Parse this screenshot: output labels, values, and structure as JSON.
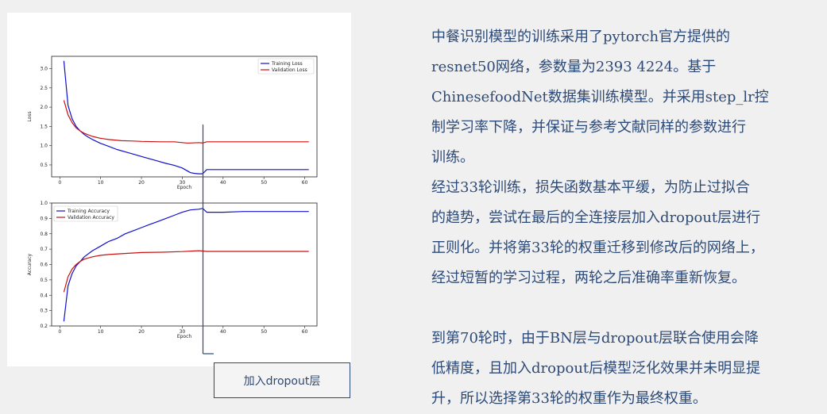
{
  "chart_data": [
    {
      "type": "line",
      "xlabel": "Epoch",
      "ylabel": "Loss",
      "xlim": [
        -2,
        63
      ],
      "ylim": [
        0.19,
        3.32
      ],
      "xticks": [
        0,
        10,
        20,
        30,
        40,
        50,
        60
      ],
      "yticks": [
        0.5,
        1.0,
        1.5,
        2.0,
        2.5,
        3.0
      ],
      "ytick_labels": [
        "0.5",
        "1.0",
        "1.5",
        "2.0",
        "2.5",
        "3.0"
      ],
      "legend_position": "top-right",
      "grid": false,
      "series": [
        {
          "name": "Training Loss",
          "color": "#1010cc",
          "x": [
            1,
            2,
            3,
            4,
            5,
            6,
            7,
            8,
            10,
            12,
            14,
            16,
            18,
            20,
            22,
            24,
            26,
            28,
            30,
            32,
            33,
            34,
            35,
            36,
            40,
            45,
            50,
            55,
            60,
            61
          ],
          "y": [
            3.2,
            2.05,
            1.7,
            1.5,
            1.38,
            1.29,
            1.22,
            1.16,
            1.06,
            0.98,
            0.9,
            0.84,
            0.78,
            0.72,
            0.66,
            0.6,
            0.54,
            0.49,
            0.42,
            0.3,
            0.28,
            0.27,
            0.27,
            0.38,
            0.38,
            0.38,
            0.38,
            0.38,
            0.38,
            0.38
          ]
        },
        {
          "name": "Validation Loss",
          "color": "#cc1010",
          "x": [
            1,
            2,
            3,
            4,
            5,
            6,
            8,
            10,
            12,
            15,
            18,
            20,
            25,
            28,
            29,
            30,
            31,
            32,
            34,
            35,
            36,
            40,
            45,
            50,
            55,
            60,
            61
          ],
          "y": [
            2.18,
            1.8,
            1.6,
            1.46,
            1.38,
            1.32,
            1.24,
            1.19,
            1.16,
            1.13,
            1.12,
            1.11,
            1.1,
            1.1,
            1.09,
            1.08,
            1.07,
            1.07,
            1.08,
            1.07,
            1.1,
            1.1,
            1.1,
            1.1,
            1.1,
            1.1,
            1.1
          ]
        }
      ]
    },
    {
      "type": "line",
      "xlabel": "Epoch",
      "ylabel": "Accuracy",
      "xlim": [
        -2,
        63
      ],
      "ylim": [
        0.2,
        1.0
      ],
      "xticks": [
        0,
        10,
        20,
        30,
        40,
        50,
        60
      ],
      "yticks": [
        0.2,
        0.3,
        0.4,
        0.5,
        0.6,
        0.7,
        0.8,
        0.9,
        1.0
      ],
      "ytick_labels": [
        "0.2",
        "0.3",
        "0.4",
        "0.5",
        "0.6",
        "0.7",
        "0.8",
        "0.9",
        "1.0"
      ],
      "legend_position": "top-left",
      "grid": false,
      "series": [
        {
          "name": "Training Accuracy",
          "color": "#1010cc",
          "x": [
            1,
            2,
            3,
            4,
            5,
            6,
            8,
            10,
            12,
            14,
            16,
            18,
            20,
            22,
            24,
            26,
            28,
            30,
            32,
            34,
            35,
            36,
            40,
            45,
            50,
            55,
            60,
            61
          ],
          "y": [
            0.23,
            0.46,
            0.54,
            0.59,
            0.62,
            0.65,
            0.69,
            0.72,
            0.75,
            0.77,
            0.8,
            0.82,
            0.84,
            0.86,
            0.88,
            0.9,
            0.92,
            0.94,
            0.955,
            0.96,
            0.965,
            0.94,
            0.94,
            0.945,
            0.945,
            0.945,
            0.945,
            0.945
          ]
        },
        {
          "name": "Validation Accuracy",
          "color": "#cc1010",
          "x": [
            1,
            2,
            3,
            4,
            5,
            6,
            8,
            10,
            12,
            15,
            18,
            20,
            25,
            30,
            34,
            35,
            36,
            40,
            45,
            50,
            55,
            60,
            61
          ],
          "y": [
            0.42,
            0.52,
            0.57,
            0.6,
            0.62,
            0.635,
            0.65,
            0.66,
            0.665,
            0.67,
            0.675,
            0.678,
            0.68,
            0.684,
            0.69,
            0.688,
            0.685,
            0.685,
            0.685,
            0.685,
            0.685,
            0.685,
            0.685
          ]
        }
      ]
    }
  ],
  "callout": {
    "label": "加入dropout层",
    "epoch": 35
  },
  "description": {
    "paragraph1": [
      "中餐识别模型的训练采用了pytorch官方提供的",
      "resnet50网络，参数量为2393 4224。基于",
      "ChinesefoodNet数据集训练模型。并采用step_lr控",
      "制学习率下降，并保证与参考文献同样的参数进行",
      "训练。"
    ],
    "paragraph2": [
      "经过33轮训练，损失函数基本平缓，为防止过拟合",
      "的趋势，尝试在最后的全连接层加入dropout层进行",
      "正则化。并将第33轮的权重迁移到修改后的网络上，",
      "经过短暂的学习过程，两轮之后准确率重新恢复。"
    ],
    "paragraph3": [
      "到第70轮时，由于BN层与dropout层联合使用会降",
      "低精度，且加入dropout后模型泛化效果并未明显提",
      "升，所以选择第33轮的权重作为最终权重。"
    ]
  }
}
